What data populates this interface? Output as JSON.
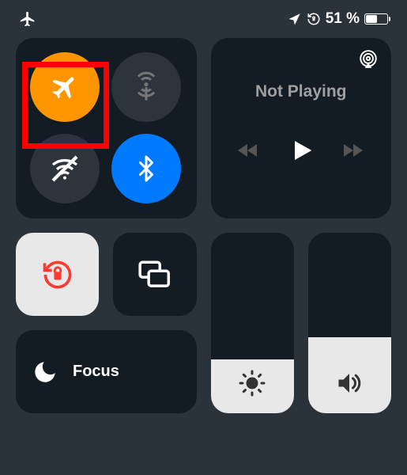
{
  "status_bar": {
    "battery_percent": "51 %"
  },
  "connectivity": {
    "airplane_on": true,
    "bluetooth_on": true
  },
  "music": {
    "title": "Not Playing"
  },
  "focus": {
    "label": "Focus"
  },
  "sliders": {
    "brightness_percent": 30,
    "volume_percent": 42
  },
  "colors": {
    "orange": "#ff9500",
    "blue": "#007aff",
    "red": "#ff3b30",
    "tile_dark": "#131b23",
    "tile_light": "#e8e8e8",
    "background": "#2a323a"
  }
}
